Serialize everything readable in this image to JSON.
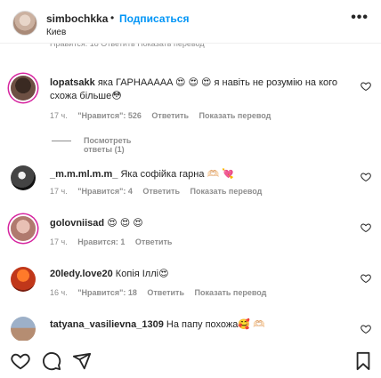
{
  "header": {
    "username": "simbochkka",
    "separator": "•",
    "follow_label": "Подписаться",
    "location": "Киев",
    "more_label": "•••",
    "ghost_text": "Нравится: 18   Ответить   Показать перевод"
  },
  "comments": [
    {
      "username": "lopatsakk",
      "text": "яка ГАРНАААAA 😍 😍 😍 я навіть не розумію на кого схожа більше😳",
      "time": "17 ч.",
      "likes": "\"Нравится\": 526",
      "reply": "Ответить",
      "translate": "Показать перевод"
    },
    {
      "username": "_m.m.ml.m.m_",
      "text": "Яка софійка гарна 🫶🏻 💘",
      "time": "17 ч.",
      "likes": "\"Нравится\": 4",
      "reply": "Ответить",
      "translate": "Показать перевод"
    },
    {
      "username": "golovniisad",
      "text": "😍 😍 😍",
      "time": "17 ч.",
      "likes": "Нравится: 1",
      "reply": "Ответить",
      "translate": ""
    },
    {
      "username": "20ledy.love20",
      "text": "Копія Іллі😍",
      "time": "16 ч.",
      "likes": "\"Нравится\": 18",
      "reply": "Ответить",
      "translate": "Показать перевод"
    },
    {
      "username": "tatyana_vasilievna_1309",
      "text": "На папу похожа🥰 🫶🏻",
      "time": "",
      "likes": "",
      "reply": "",
      "translate": ""
    }
  ],
  "replies_label": "Посмотреть ответы (1)",
  "icons": {
    "like": "heart-icon",
    "comment": "comment-icon",
    "share": "send-icon",
    "save": "bookmark-icon",
    "comment_like": "heart-outline-icon"
  }
}
